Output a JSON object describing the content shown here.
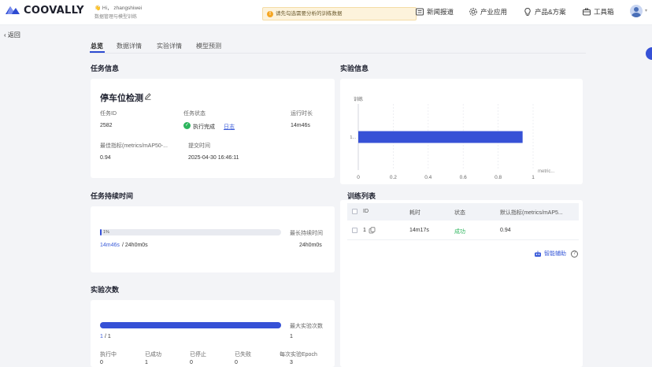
{
  "header": {
    "brand": "COOVALLY",
    "greeting": "Hi， zhangshiwei",
    "subtitle": "数据管理与模型训练",
    "toast": "请先勾选需要分析的训练数据",
    "nav": [
      "新闻报道",
      "产业应用",
      "产品&方案",
      "工具箱"
    ]
  },
  "back": "返回",
  "tabs": [
    "总览",
    "数据详情",
    "实验详情",
    "模型预测"
  ],
  "task": {
    "section": "任务信息",
    "name": "停车位检测",
    "id_label": "任务ID",
    "id": "2582",
    "status_label": "任务状态",
    "status": "执行完成",
    "log_link": "日志",
    "runtime_label": "运行时长",
    "runtime": "14m46s",
    "metric_label": "最佳指标(metrics/mAP50-...",
    "metric": "0.94",
    "submit_label": "提交时间",
    "submit": "2025-04-30 16:46:11"
  },
  "duration": {
    "section": "任务持续时间",
    "percent_text": "1%",
    "percent": 1,
    "max_label": "最长持续时间",
    "used": "14m46s",
    "total": "/ 24h0m0s",
    "max": "24h0m0s"
  },
  "experiments": {
    "section": "实验次数",
    "fraction": 1.0,
    "max_label": "最大实验次数",
    "count_used": "1",
    "count_total": "/ 1",
    "max": "1",
    "stats": [
      {
        "label": "执行中",
        "value": "0"
      },
      {
        "label": "已成功",
        "value": "1"
      },
      {
        "label": "已停止",
        "value": "0"
      },
      {
        "label": "已失败",
        "value": "0"
      },
      {
        "label": "每次实验Epoch",
        "value": "3"
      }
    ]
  },
  "experiment_info": {
    "section": "实验信息"
  },
  "chart_data": {
    "type": "bar",
    "orientation": "horizontal",
    "categories": [
      "1"
    ],
    "values": [
      0.94
    ],
    "ylabel": "训练",
    "xlabel": "metric...",
    "xlim": [
      0,
      1
    ],
    "xticks": [
      "0",
      "0.2",
      "0.4",
      "0.6",
      "0.8",
      "1"
    ],
    "category_ticks": [
      "1..."
    ],
    "color": "#3651d6",
    "grid": true
  },
  "train_list": {
    "section": "训练列表",
    "columns": [
      "ID",
      "耗时",
      "状态",
      "默认指标(metrics/mAP5..."
    ],
    "rows": [
      {
        "id": "1",
        "time": "14m17s",
        "status": "成功",
        "metric": "0.94"
      }
    ],
    "assist": "智能辅助"
  },
  "colors": {
    "accent": "#3651d6",
    "success": "#2db55d",
    "link": "#3a5bd9"
  }
}
